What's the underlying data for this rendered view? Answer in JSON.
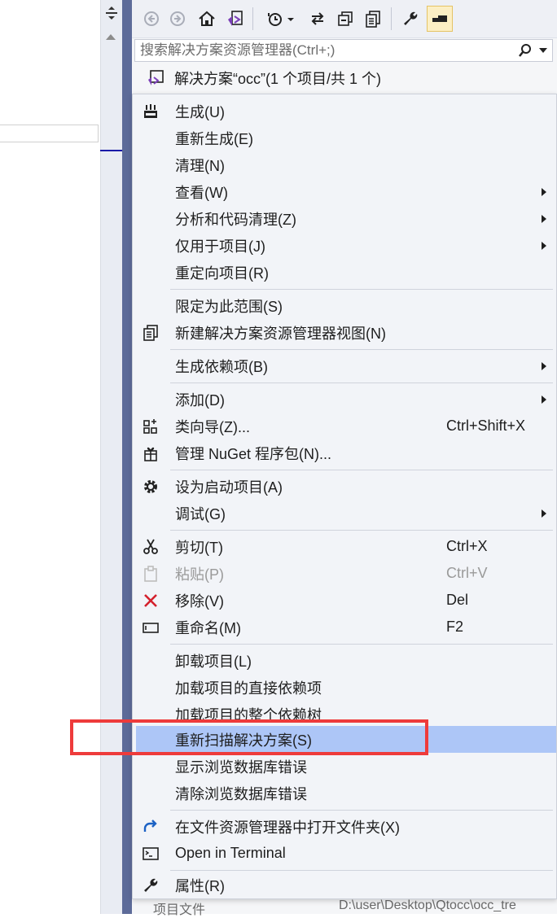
{
  "search": {
    "placeholder": "搜索解决方案资源管理器(Ctrl+;)"
  },
  "solution": {
    "label": "解决方案“occ”(1 个项目/共 1 个)"
  },
  "properties_row": {
    "key": "项目文件",
    "value": "D:\\user\\Desktop\\Qtocc\\occ_tre"
  },
  "menu": {
    "items": [
      {
        "label": "生成(U)",
        "shortcut": ""
      },
      {
        "label": "重新生成(E)",
        "shortcut": ""
      },
      {
        "label": "清理(N)",
        "shortcut": ""
      },
      {
        "label": "查看(W)",
        "shortcut": ""
      },
      {
        "label": "分析和代码清理(Z)",
        "shortcut": ""
      },
      {
        "label": "仅用于项目(J)",
        "shortcut": ""
      },
      {
        "label": "重定向项目(R)",
        "shortcut": ""
      },
      {
        "label": "限定为此范围(S)",
        "shortcut": ""
      },
      {
        "label": "新建解决方案资源管理器视图(N)",
        "shortcut": ""
      },
      {
        "label": "生成依赖项(B)",
        "shortcut": ""
      },
      {
        "label": "添加(D)",
        "shortcut": ""
      },
      {
        "label": "类向导(Z)...",
        "shortcut": "Ctrl+Shift+X"
      },
      {
        "label": "管理 NuGet 程序包(N)...",
        "shortcut": ""
      },
      {
        "label": "设为启动项目(A)",
        "shortcut": ""
      },
      {
        "label": "调试(G)",
        "shortcut": ""
      },
      {
        "label": "剪切(T)",
        "shortcut": "Ctrl+X"
      },
      {
        "label": "粘贴(P)",
        "shortcut": "Ctrl+V"
      },
      {
        "label": "移除(V)",
        "shortcut": "Del"
      },
      {
        "label": "重命名(M)",
        "shortcut": "F2"
      },
      {
        "label": "卸载项目(L)",
        "shortcut": ""
      },
      {
        "label": "加载项目的直接依赖项",
        "shortcut": ""
      },
      {
        "label": "加载项目的整个依赖树",
        "shortcut": ""
      },
      {
        "label": "重新扫描解决方案(S)",
        "shortcut": ""
      },
      {
        "label": "显示浏览数据库错误",
        "shortcut": ""
      },
      {
        "label": "清除浏览数据库错误",
        "shortcut": ""
      },
      {
        "label": "在文件资源管理器中打开文件夹(X)",
        "shortcut": ""
      },
      {
        "label": "Open in Terminal",
        "shortcut": ""
      },
      {
        "label": "属性(R)",
        "shortcut": ""
      }
    ]
  },
  "colors": {
    "highlight": "#adc6f7",
    "annotation": "#ee3b3b",
    "remove_icon": "#d4202c",
    "panel_border": "#5d6b99"
  }
}
